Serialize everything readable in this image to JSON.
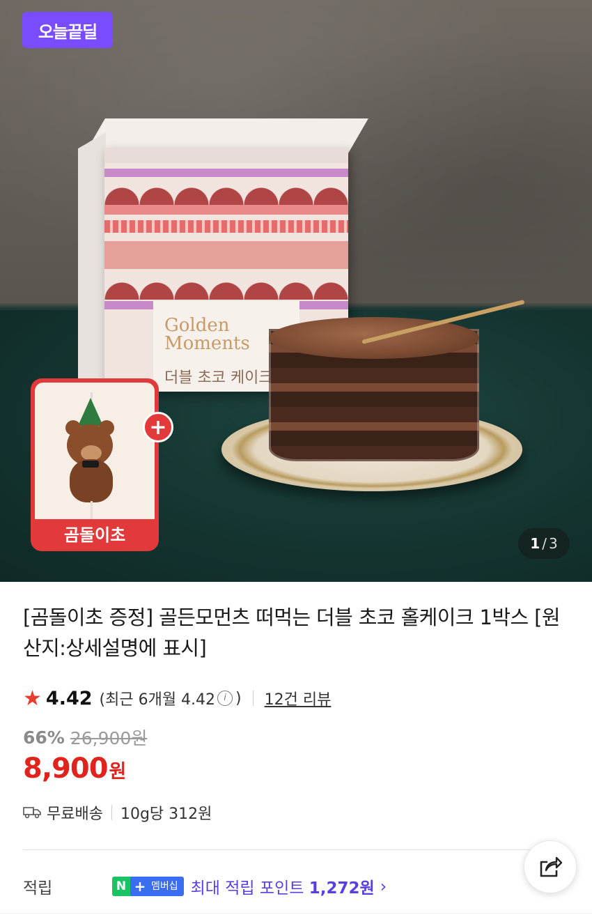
{
  "hero": {
    "deal_badge": "오늘끝딜",
    "package_brand": "Golden Moments",
    "package_brand_line1": "Golden",
    "package_brand_line2": "Moments",
    "package_name": "더블 초코 케이크",
    "gift_label": "곰돌이초",
    "gift_plus": "+",
    "pager": {
      "current": "1",
      "separator": "/",
      "total": "3"
    }
  },
  "product": {
    "title": "[곰돌이초 증정] 골든모먼츠 떠먹는 더블 초코 홀케이크 1박스 [원산지:상세설명에 표시]",
    "rating": "4.42",
    "recent_rating": "(최근 6개월 4.42",
    "recent_rating_close": ")",
    "review_count": "12건 리뷰",
    "discount_rate": "66%",
    "original_price": "26,900원",
    "price": "8,900",
    "price_unit": "원",
    "shipping": "무료배송",
    "unit_price": "10g당 312원"
  },
  "points": {
    "label": "적립",
    "badge_n": "N",
    "badge_plus": "+",
    "badge_membership": "멤버십",
    "text_prefix": "최대 적립 포인트 ",
    "amount": "1,272원"
  },
  "colors": {
    "deal_badge": "#7a4cff",
    "price_red": "#e0231d",
    "star": "#e83c2f",
    "points_purple": "#5a3fe0",
    "naver_green": "#19c263",
    "membership_blue": "#3a6ef0"
  },
  "icons": {
    "rating": "star-icon",
    "info": "info-icon",
    "shipping": "truck-icon",
    "share": "share-icon",
    "more": "chevron-right-icon"
  }
}
